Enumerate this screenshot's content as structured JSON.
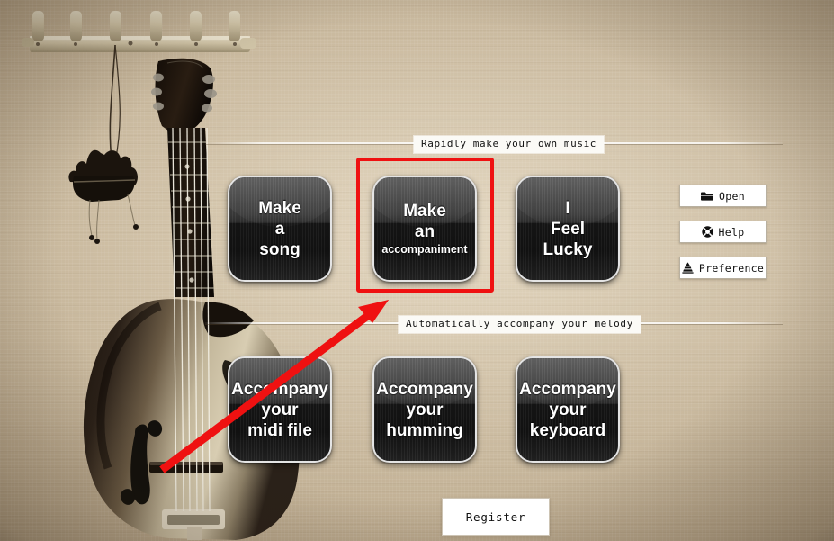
{
  "app": {
    "background_color": "#bba884",
    "accent_color": "#ef1111"
  },
  "sections": [
    {
      "id": "make-music",
      "header": "Rapidly make your own music",
      "tiles": [
        {
          "id": "make-a-song",
          "lines": [
            "Make",
            "a",
            "song"
          ],
          "small_line_index": -1
        },
        {
          "id": "make-an-accompaniment",
          "lines": [
            "Make",
            "an",
            "accompaniment"
          ],
          "small_line_index": 2
        },
        {
          "id": "i-feel-lucky",
          "lines": [
            "I",
            "Feel",
            "Lucky"
          ],
          "small_line_index": -1
        }
      ]
    },
    {
      "id": "auto-accompany",
      "header": "Automatically accompany your melody",
      "tiles": [
        {
          "id": "accompany-your-midi-file",
          "lines": [
            "Accompany",
            "your",
            "midi file"
          ],
          "small_line_index": -1
        },
        {
          "id": "accompany-your-humming",
          "lines": [
            "Accompany",
            "your",
            "humming"
          ],
          "small_line_index": -1
        },
        {
          "id": "accompany-your-keyboard",
          "lines": [
            "Accompany",
            "your",
            "keyboard"
          ],
          "small_line_index": -1
        }
      ]
    }
  ],
  "tile_labels": {
    "make_a_song_l1": "Make",
    "make_a_song_l2": "a",
    "make_a_song_l3": "song",
    "make_an_accompaniment_l1": "Make",
    "make_an_accompaniment_l2": "an",
    "make_an_accompaniment_l3": "accompaniment",
    "i_feel_lucky_l1": "I",
    "i_feel_lucky_l2": "Feel",
    "i_feel_lucky_l3": "Lucky",
    "midi_l1": "Accompany",
    "midi_l2": "your",
    "midi_l3": "midi file",
    "humming_l1": "Accompany",
    "humming_l2": "your",
    "humming_l3": "humming",
    "keyboard_l1": "Accompany",
    "keyboard_l2": "your",
    "keyboard_l3": "keyboard"
  },
  "section_headers": {
    "first": "Rapidly make your own music",
    "second": "Automatically accompany your melody"
  },
  "side_buttons": [
    {
      "id": "open",
      "label": "Open",
      "icon": "folder-open-icon"
    },
    {
      "id": "help",
      "label": "Help",
      "icon": "lifebuoy-icon"
    },
    {
      "id": "preference",
      "label": "Preference",
      "icon": "cone-stack-icon"
    }
  ],
  "side_button_labels": {
    "open": "Open",
    "help": "Help",
    "preference": "Preference"
  },
  "footer": {
    "register_label": "Register"
  },
  "annotation": {
    "highlight_target": "make-an-accompaniment",
    "highlight_color": "#ef1111",
    "arrow_from": "180,522",
    "arrow_to": "432,333"
  }
}
